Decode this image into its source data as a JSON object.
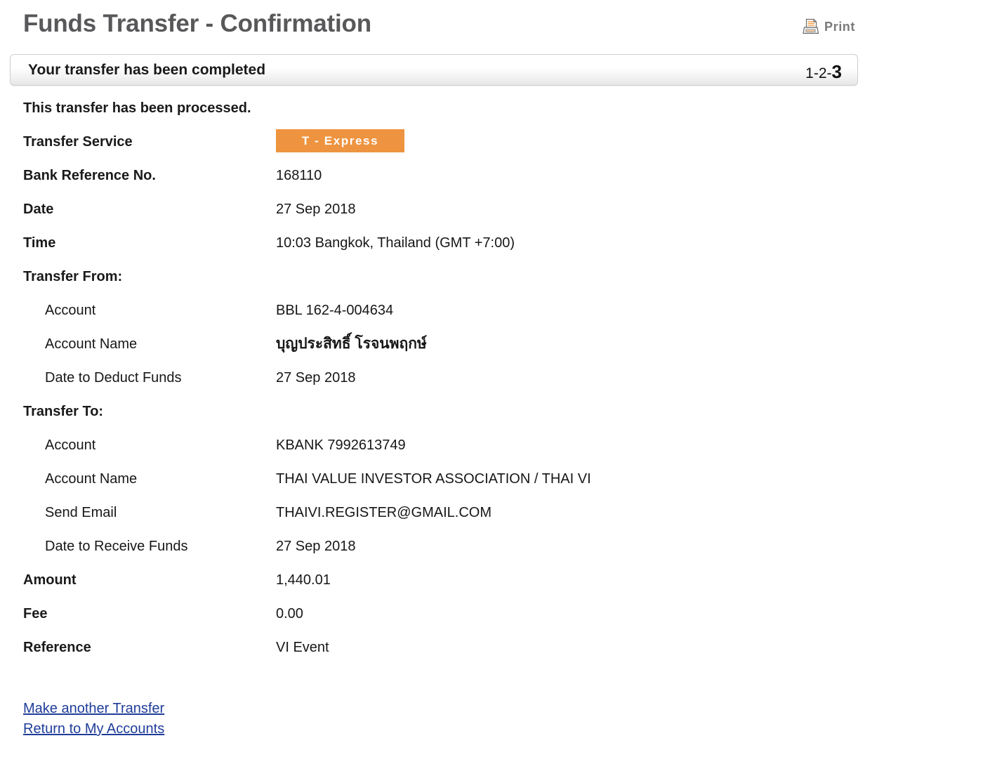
{
  "header": {
    "title": "Funds Transfer - Confirmation",
    "print_label": "Print",
    "print_icon": "printer-icon"
  },
  "status": {
    "message": "Your transfer has been completed",
    "step_prefix": "1-2-",
    "step_current": "3"
  },
  "notice": "This transfer has been processed.",
  "service": {
    "label": "Transfer Service",
    "badge_text": "T - Express",
    "badge_color": "#ee9440"
  },
  "details": [
    {
      "label": "Bank Reference No.",
      "value": "168110"
    },
    {
      "label": "Date",
      "value": "27 Sep 2018"
    },
    {
      "label": "Time",
      "value": "10:03 Bangkok, Thailand (GMT +7:00)"
    }
  ],
  "transfer_from": {
    "heading": "Transfer From:",
    "rows": [
      {
        "label": "Account",
        "value": "BBL 162-4-004634"
      },
      {
        "label": "Account Name",
        "value": "บุญประสิทธิ์ โรจนพฤกษ์"
      },
      {
        "label": "Date to Deduct Funds",
        "value": "27 Sep 2018"
      }
    ]
  },
  "transfer_to": {
    "heading": "Transfer To:",
    "rows": [
      {
        "label": "Account",
        "value": "KBANK 7992613749"
      },
      {
        "label": "Account Name",
        "value": "THAI VALUE INVESTOR ASSOCIATION / THAI VI"
      },
      {
        "label": "Send Email",
        "value": "THAIVI.REGISTER@GMAIL.COM"
      },
      {
        "label": "Date to Receive Funds",
        "value": "27 Sep 2018"
      }
    ]
  },
  "totals": [
    {
      "label": "Amount",
      "value": "1,440.01"
    },
    {
      "label": "Fee",
      "value": "0.00"
    },
    {
      "label": "Reference",
      "value": "VI Event"
    }
  ],
  "links": [
    {
      "label": "Make another Transfer"
    },
    {
      "label": "Return to My Accounts"
    }
  ],
  "colors": {
    "title": "#58585a",
    "link": "#1f3d99",
    "accent": "#ee9440"
  }
}
